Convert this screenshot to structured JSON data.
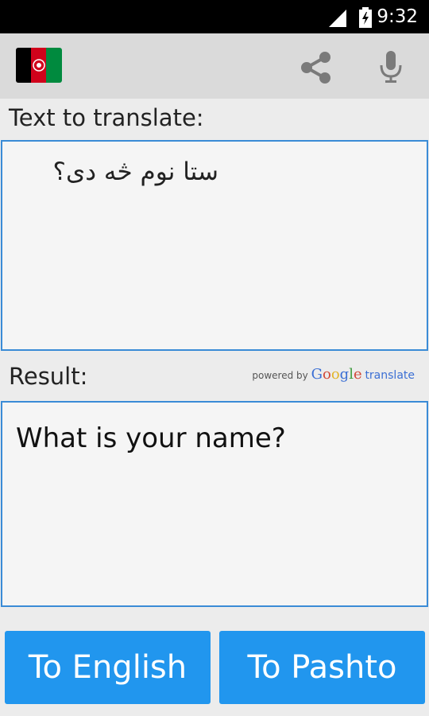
{
  "status": {
    "time": "9:32"
  },
  "action_bar": {
    "flag_icon": "afghanistan-flag",
    "share_icon": "share-icon",
    "mic_icon": "microphone-icon"
  },
  "input": {
    "label": "Text to translate:",
    "value": "ستا نوم څه دی؟"
  },
  "result": {
    "label": "Result:",
    "value": "What is your name?",
    "powered_prefix": "powered by",
    "powered_brand": "Google",
    "powered_suffix": "translate"
  },
  "buttons": {
    "to_english": "To English",
    "to_pashto": "To Pashto"
  },
  "colors": {
    "accent": "#2196ee",
    "border": "#3a8bd6",
    "flag_black": "#000000",
    "flag_red": "#d0021b",
    "flag_green": "#008a3e"
  }
}
